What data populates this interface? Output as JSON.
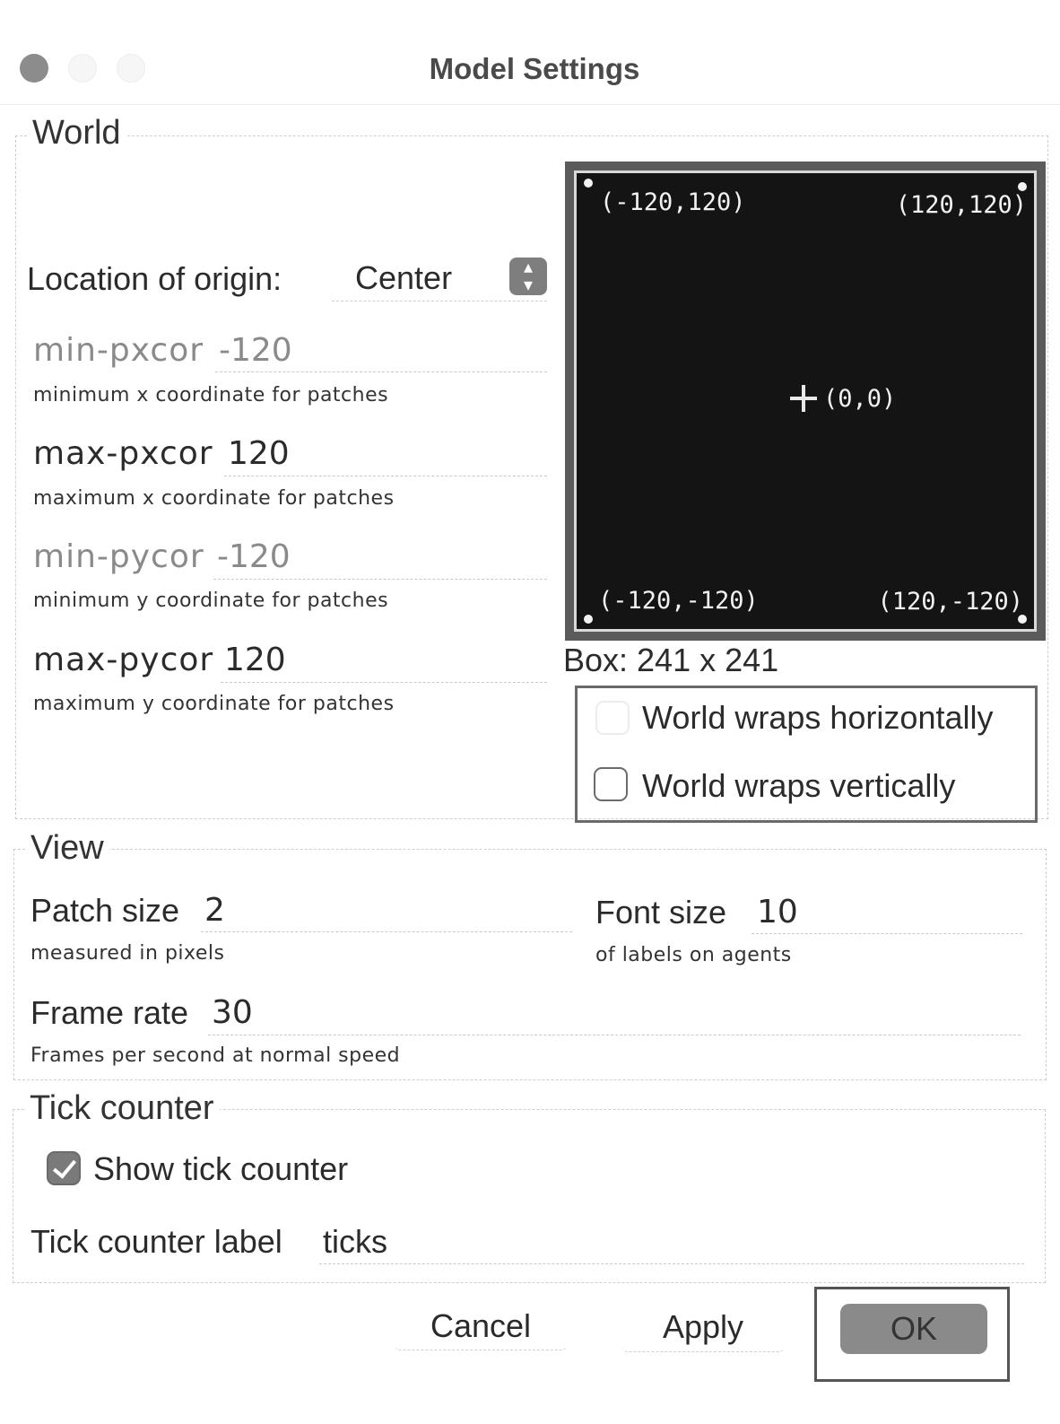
{
  "window": {
    "title": "Model Settings"
  },
  "world": {
    "legend": "World",
    "origin_label": "Location of origin:",
    "origin_value": "Center",
    "min_pxcor": {
      "label": "min-pxcor",
      "value": "-120",
      "hint": "minimum x coordinate for patches"
    },
    "max_pxcor": {
      "label": "max-pxcor",
      "value": "120",
      "hint": "maximum x coordinate for patches"
    },
    "min_pycor": {
      "label": "min-pycor",
      "value": "-120",
      "hint": "minimum y coordinate for patches"
    },
    "max_pycor": {
      "label": "max-pycor",
      "value": "120",
      "hint": "maximum y coordinate for patches"
    },
    "preview": {
      "top_left": "(-120,120)",
      "top_right": "(120,120)",
      "center": "(0,0)",
      "bottom_left": "(-120,-120)",
      "bottom_right": "(120,-120)"
    },
    "box_label": "Box: 241 x 241",
    "wrap_horizontal": {
      "label": "World wraps horizontally",
      "checked": false
    },
    "wrap_vertical": {
      "label": "World wraps vertically",
      "checked": false
    }
  },
  "view": {
    "legend": "View",
    "patch_size": {
      "label": "Patch size",
      "value": "2",
      "hint": "measured in pixels"
    },
    "font_size": {
      "label": "Font size",
      "value": "10",
      "hint": "of labels on agents"
    },
    "frame_rate": {
      "label": "Frame rate",
      "value": "30",
      "hint": "Frames per second at normal speed"
    }
  },
  "tick_counter": {
    "legend": "Tick counter",
    "show_label": "Show tick counter",
    "show_checked": true,
    "label_label": "Tick counter label",
    "label_value": "ticks"
  },
  "buttons": {
    "cancel": "Cancel",
    "apply": "Apply",
    "ok": "OK"
  },
  "colors": {
    "preview_bg": "#141414",
    "ok_button": "#8a8a8a",
    "checkbox_checked": "#7a7a7a"
  },
  "icons": {
    "origin_select": "up-down-chevron-icon",
    "center_marker": "crosshair-icon"
  }
}
